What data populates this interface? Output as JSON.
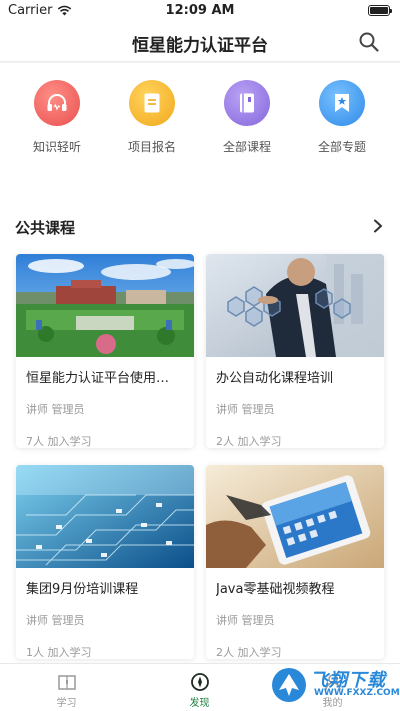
{
  "status_bar": {
    "carrier": "Carrier",
    "time": "12:09 AM"
  },
  "header": {
    "title": "恒星能力认证平台",
    "search_icon": "search-icon"
  },
  "quick_menu": [
    {
      "label": "知识轻听",
      "icon": "headphones-icon",
      "color": "#f06e6c"
    },
    {
      "label": "项目报名",
      "icon": "document-icon",
      "color": "#f8bb31"
    },
    {
      "label": "全部课程",
      "icon": "book-icon",
      "color": "#9b7fe6"
    },
    {
      "label": "全部专题",
      "icon": "bookmark-star-icon",
      "color": "#3e9cf0"
    }
  ],
  "public_courses": {
    "title": "公共课程",
    "more_icon": "chevron-right-icon",
    "courses": [
      {
        "title": "恒星能力认证平台使用…",
        "teacher": "讲师 管理员",
        "students": "7人 加入学习",
        "image": "campus-photo"
      },
      {
        "title": "办公自动化课程培训",
        "teacher": "讲师 管理员",
        "students": "2人 加入学习",
        "image": "business-hexagon-photo"
      },
      {
        "title": "集团9月份培训课程",
        "teacher": "讲师 管理员",
        "students": "1人 加入学习",
        "image": "circuit-board-photo"
      },
      {
        "title": "Java零基础视频教程",
        "teacher": "讲师 管理员",
        "students": "2人 加入学习",
        "image": "tablet-photo"
      }
    ]
  },
  "tab_bar": {
    "tabs": [
      {
        "label": "学习",
        "icon": "book-open-icon",
        "active": false
      },
      {
        "label": "发现",
        "icon": "compass-icon",
        "active": true
      },
      {
        "label": "我的",
        "icon": "user-icon",
        "active": false
      }
    ],
    "active_color": "#1e7d3d"
  },
  "watermark": {
    "text": "飞翔下载",
    "url": "WWW.FXXZ.COM"
  }
}
